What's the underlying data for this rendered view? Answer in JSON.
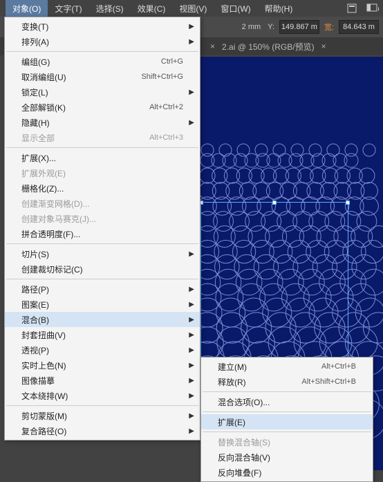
{
  "menubar": {
    "items": [
      "对象(O)",
      "文字(T)",
      "选择(S)",
      "效果(C)",
      "视图(V)",
      "窗口(W)",
      "帮助(H)"
    ],
    "active_index": 0
  },
  "toolbar": {
    "x_suffix": "2 mm",
    "y_label": "Y:",
    "y_value": "149.867 m",
    "w_label": "宽:",
    "w_value": "84.643 m"
  },
  "tabbar": {
    "close_glyph": "×",
    "title": "2.ai @ 150% (RGB/预览)",
    "close2": "×"
  },
  "menu": [
    {
      "label": "变换(T)",
      "arrow": true
    },
    {
      "label": "排列(A)",
      "arrow": true
    },
    {
      "sep": true
    },
    {
      "label": "编组(G)",
      "shortcut": "Ctrl+G"
    },
    {
      "label": "取消编组(U)",
      "shortcut": "Shift+Ctrl+G"
    },
    {
      "label": "锁定(L)",
      "arrow": true
    },
    {
      "label": "全部解锁(K)",
      "shortcut": "Alt+Ctrl+2"
    },
    {
      "label": "隐藏(H)",
      "arrow": true
    },
    {
      "label": "显示全部",
      "shortcut": "Alt+Ctrl+3",
      "disabled": true
    },
    {
      "sep": true
    },
    {
      "label": "扩展(X)..."
    },
    {
      "label": "扩展外观(E)",
      "disabled": true
    },
    {
      "label": "栅格化(Z)..."
    },
    {
      "label": "创建渐变网格(D)...",
      "disabled": true
    },
    {
      "label": "创建对象马赛克(J)...",
      "disabled": true
    },
    {
      "label": "拼合透明度(F)..."
    },
    {
      "sep": true
    },
    {
      "label": "切片(S)",
      "arrow": true
    },
    {
      "label": "创建裁切标记(C)"
    },
    {
      "sep": true
    },
    {
      "label": "路径(P)",
      "arrow": true
    },
    {
      "label": "图案(E)",
      "arrow": true
    },
    {
      "label": "混合(B)",
      "arrow": true,
      "highlighted": true
    },
    {
      "label": "封套扭曲(V)",
      "arrow": true
    },
    {
      "label": "透视(P)",
      "arrow": true
    },
    {
      "label": "实时上色(N)",
      "arrow": true
    },
    {
      "label": "图像描摹",
      "arrow": true
    },
    {
      "label": "文本绕排(W)",
      "arrow": true
    },
    {
      "sep": true
    },
    {
      "label": "剪切蒙版(M)",
      "arrow": true
    },
    {
      "label": "复合路径(O)",
      "arrow": true
    }
  ],
  "submenu": [
    {
      "label": "建立(M)",
      "shortcut": "Alt+Ctrl+B"
    },
    {
      "label": "释放(R)",
      "shortcut": "Alt+Shift+Ctrl+B"
    },
    {
      "sep": true
    },
    {
      "label": "混合选项(O)..."
    },
    {
      "sep": true
    },
    {
      "label": "扩展(E)",
      "highlighted": true
    },
    {
      "sep": true
    },
    {
      "label": "替换混合轴(S)",
      "disabled": true
    },
    {
      "label": "反向混合轴(V)"
    },
    {
      "label": "反向堆叠(F)"
    }
  ]
}
